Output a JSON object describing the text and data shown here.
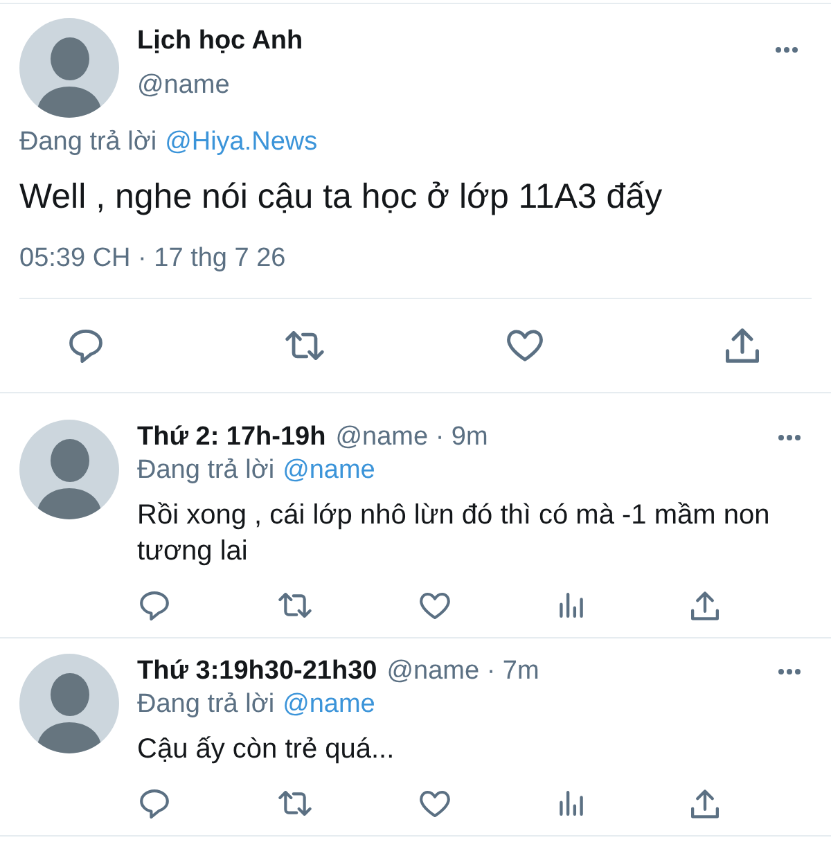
{
  "main_tweet": {
    "display_name": "Lịch học Anh",
    "handle": "@name",
    "replying_to_label": "Đang trả lời",
    "replying_to": "@Hiya.News",
    "text": "Well , nghe nói cậu ta học ở lớp 11A3 đấy",
    "timestamp": "05:39 CH · 17 thg 7 26",
    "actions": [
      {
        "kind": "reply"
      },
      {
        "kind": "retweet"
      },
      {
        "kind": "like"
      },
      {
        "kind": "share"
      }
    ]
  },
  "replies": [
    {
      "display_name": "Thứ 2: 17h-19h",
      "meta": "@name · 9m",
      "replying_to_label": "Đang trả lời",
      "replying_to": "@name",
      "text": "Rồi xong , cái lớp nhô lừn đó thì có mà -1 mầm non tương lai",
      "actions": [
        {
          "kind": "reply"
        },
        {
          "kind": "retweet"
        },
        {
          "kind": "like"
        },
        {
          "kind": "views"
        },
        {
          "kind": "share"
        }
      ]
    },
    {
      "display_name": "Thứ 3:19h30-21h30",
      "meta": "@name · 7m",
      "replying_to_label": "Đang trả lời",
      "replying_to": "@name",
      "text": "Cậu ấy còn trẻ quá...",
      "actions": [
        {
          "kind": "reply"
        },
        {
          "kind": "retweet"
        },
        {
          "kind": "like"
        },
        {
          "kind": "views"
        },
        {
          "kind": "share"
        }
      ]
    }
  ]
}
